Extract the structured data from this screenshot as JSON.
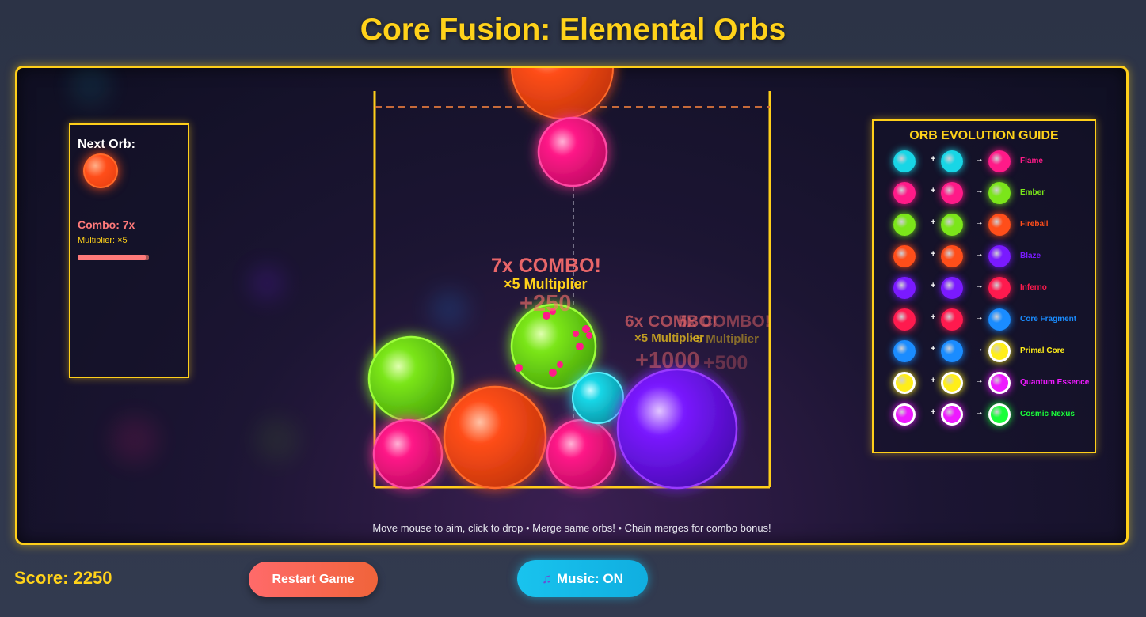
{
  "title": "Core Fusion: Elemental Orbs",
  "next_panel": {
    "label": "Next Orb:",
    "next_orb": "fireball",
    "combo": "Combo: 7x",
    "multiplier": "Multiplier: ×5",
    "combo_progress": 0.95
  },
  "guide": {
    "title": "ORB EVOLUTION GUIDE",
    "plus": "+",
    "arrow": "→",
    "rows": [
      {
        "a": "#18d6e6",
        "b": "#18d6e6",
        "result": "#ff1a88",
        "name": "Flame",
        "name_color": "#ff1a88"
      },
      {
        "a": "#ff1a88",
        "b": "#ff1a88",
        "result": "#7be61a",
        "name": "Ember",
        "name_color": "#7be61a"
      },
      {
        "a": "#7be61a",
        "b": "#7be61a",
        "result": "#ff4e1a",
        "name": "Fireball",
        "name_color": "#ff4e1a"
      },
      {
        "a": "#ff4e1a",
        "b": "#ff4e1a",
        "result": "#7a1aff",
        "name": "Blaze",
        "name_color": "#7a1aff"
      },
      {
        "a": "#7a1aff",
        "b": "#7a1aff",
        "result": "#ff1a4e",
        "name": "Inferno",
        "name_color": "#ff1a4e"
      },
      {
        "a": "#ff1a4e",
        "b": "#ff1a4e",
        "result": "#1a8cff",
        "name": "Core Fragment",
        "name_color": "#1a8cff"
      },
      {
        "a": "#1a8cff",
        "b": "#1a8cff",
        "result": "#ffee1a",
        "name": "Primal Core",
        "name_color": "#ffee1a"
      },
      {
        "a": "#ffee1a",
        "b": "#ffee1a",
        "result": "#ee1aff",
        "name": "Quantum Essence",
        "name_color": "#ee1aff"
      },
      {
        "a": "#ee1aff",
        "b": "#ee1aff",
        "result": "#1aff3a",
        "name": "Cosmic Nexus",
        "name_color": "#1aff3a"
      }
    ]
  },
  "floating": {
    "combo7": "7x COMBO!",
    "mult7": "×5 Multiplier",
    "points7": "+250",
    "combo6": "6x COMBO!",
    "mult6": "×5 Multiplier",
    "points6": "+1000",
    "combo_b": "5x COMBO!",
    "mult_b": "×5 Multiplier",
    "points_b": "+500"
  },
  "hint": "Move mouse to aim, click to drop • Merge same orbs! • Chain merges for combo bonus!",
  "score": "Score: 2250",
  "restart_label": "Restart Game",
  "music_label": "Music: ON",
  "music_icon": "music-note-icon",
  "colors": {
    "accent": "#ffcf1a",
    "flame": "#ff1a88",
    "ember": "#7be61a",
    "fireball": "#ff4e1a",
    "blaze": "#7a1aff",
    "water": "#18d6e6"
  }
}
